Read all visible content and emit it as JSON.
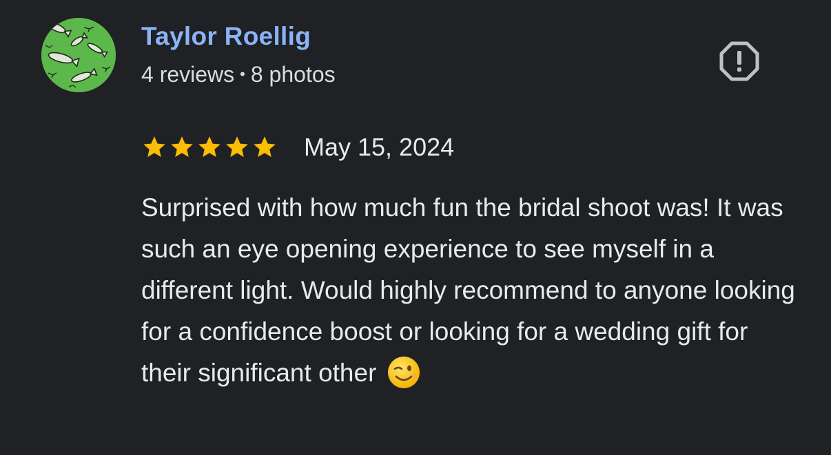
{
  "author": {
    "name": "Taylor Roellig",
    "reviews": "4 reviews",
    "separator": "•",
    "photos": "8 photos",
    "avatar_icon": "fish-pattern-avatar"
  },
  "review": {
    "rating": 5,
    "rating_max": 5,
    "date": "May 15, 2024",
    "text": "Surprised with how much fun the bridal shoot was! It was such an eye opening experience to see myself in a different light. Would highly recommend to anyone looking for a confidence boost or looking for a wedding gift for their significant other",
    "emoji": "winking-face-emoji"
  },
  "actions": {
    "report_icon": "report-octagon-icon"
  },
  "colors": {
    "background": "#202124",
    "author_name": "#8ab4f8",
    "star": "#fbbc04",
    "text": "#e8eaed",
    "avatar_bg": "#5cb84a"
  }
}
